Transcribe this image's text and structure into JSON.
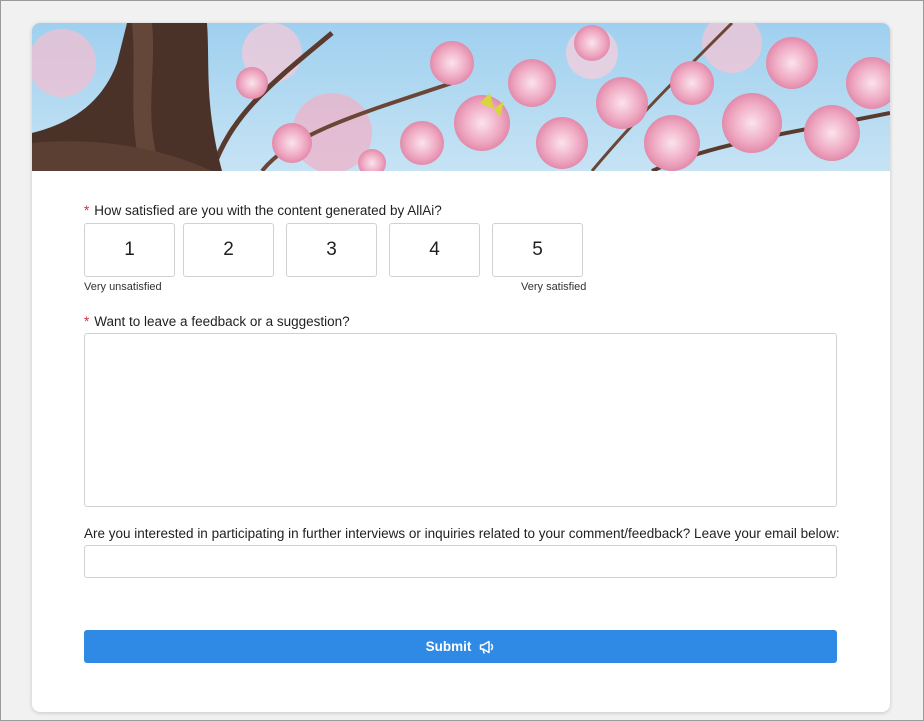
{
  "colors": {
    "accent": "#2f8ae5",
    "required": "#d13438",
    "border": "#d1d1d1"
  },
  "banner": {
    "image": "cherry-blossom-banner"
  },
  "rating_question": {
    "required_mark": "*",
    "label": "How satisfied are you with the content generated by AllAi?",
    "options": [
      "1",
      "2",
      "3",
      "4",
      "5"
    ],
    "low_label": "Very unsatisfied",
    "high_label": "Very satisfied"
  },
  "feedback_question": {
    "required_mark": "*",
    "label": "Want to leave a feedback or a suggestion?",
    "value": ""
  },
  "email_question": {
    "label": "Are you interested in participating in further interviews or inquiries related to your comment/feedback? Leave your email below:",
    "value": ""
  },
  "submit": {
    "label": "Submit",
    "icon": "megaphone-icon"
  }
}
